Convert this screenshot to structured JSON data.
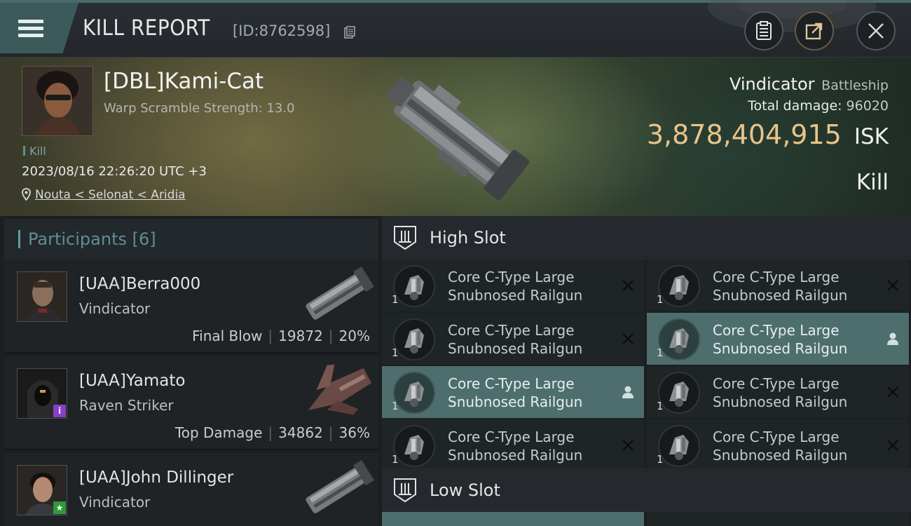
{
  "header": {
    "title": "KILL REPORT",
    "report_id": "[ID:8762598]"
  },
  "victim": {
    "name": "[DBL]Kami-Cat",
    "warp_scramble": "Warp Scramble Strength: 13.0",
    "kill_tag": "Kill",
    "datetime": "2023/08/16 22:26:20 UTC +3",
    "location": "Nouta < Selonat < Aridia",
    "ship": "Vindicator",
    "ship_class": "Battleship",
    "total_damage_label": "Total damage:",
    "total_damage": "96020",
    "isk_value": "3,878,404,915",
    "isk_unit": "ISK",
    "result": "Kill"
  },
  "participants": {
    "title": "Participants",
    "count": "[6]",
    "items": [
      {
        "name": "[UAA]Berra000",
        "ship": "Vindicator",
        "role": "Final Blow",
        "damage": "19872",
        "percent": "20%",
        "badge": ""
      },
      {
        "name": "[UAA]Yamato",
        "ship": "Raven Striker",
        "role": "Top Damage",
        "damage": "34862",
        "percent": "36%",
        "badge": "i"
      },
      {
        "name": "[UAA]John Dillinger",
        "ship": "Vindicator",
        "role": "",
        "damage": "",
        "percent": "",
        "badge": "★"
      }
    ]
  },
  "slots": {
    "high_label": "High Slot",
    "low_label": "Low Slot",
    "high_modules": [
      {
        "qty": "1",
        "name_line1": "Core C-Type Large",
        "name_line2": "Snubnosed Railgun",
        "state": "destroyed"
      },
      {
        "qty": "1",
        "name_line1": "Core C-Type Large",
        "name_line2": "Snubnosed Railgun",
        "state": "destroyed"
      },
      {
        "qty": "1",
        "name_line1": "Core C-Type Large",
        "name_line2": "Snubnosed Railgun",
        "state": "destroyed"
      },
      {
        "qty": "1",
        "name_line1": "Core C-Type Large",
        "name_line2": "Snubnosed Railgun",
        "state": "dropped"
      },
      {
        "qty": "1",
        "name_line1": "Core C-Type Large",
        "name_line2": "Snubnosed Railgun",
        "state": "dropped"
      },
      {
        "qty": "1",
        "name_line1": "Core C-Type Large",
        "name_line2": "Snubnosed Railgun",
        "state": "destroyed"
      },
      {
        "qty": "1",
        "name_line1": "Core C-Type Large",
        "name_line2": "Snubnosed Railgun",
        "state": "destroyed"
      },
      {
        "qty": "1",
        "name_line1": "Core C-Type Large",
        "name_line2": "Snubnosed Railgun",
        "state": "destroyed"
      }
    ]
  },
  "colors": {
    "accent": "#4d6e6d",
    "isk": "#e8c48b",
    "participants_title": "#5f8e93"
  },
  "icons": {
    "menu": "hamburger-icon",
    "copy": "copy-icon",
    "clipboard": "clipboard-icon",
    "share": "share-icon",
    "close": "close-icon",
    "destroyed": "x-icon",
    "dropped": "person-icon",
    "slot": "high-slot-icon"
  }
}
